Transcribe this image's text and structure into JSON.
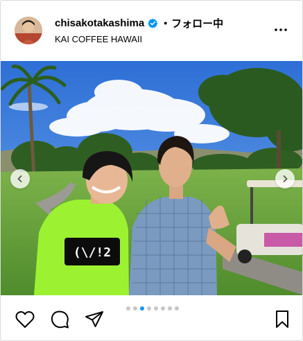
{
  "header": {
    "username": "chisakotakashima",
    "separator": "•",
    "follow_label": "フォロー中",
    "location": "KAI COFFEE HAWAII",
    "verified_icon": "verified-badge-icon",
    "more_icon": "more-options-icon"
  },
  "media": {
    "shirt_print": "(\\/!2",
    "prev_icon": "chevron-left-icon",
    "next_icon": "chevron-right-icon"
  },
  "carousel": {
    "total": 8,
    "active_index": 2
  },
  "actions": {
    "like_icon": "heart-icon",
    "comment_icon": "comment-icon",
    "share_icon": "share-icon",
    "save_icon": "bookmark-icon"
  },
  "colors": {
    "accent": "#0095f6",
    "verified": "#0095f6",
    "dot_inactive": "#c7c7c7"
  }
}
